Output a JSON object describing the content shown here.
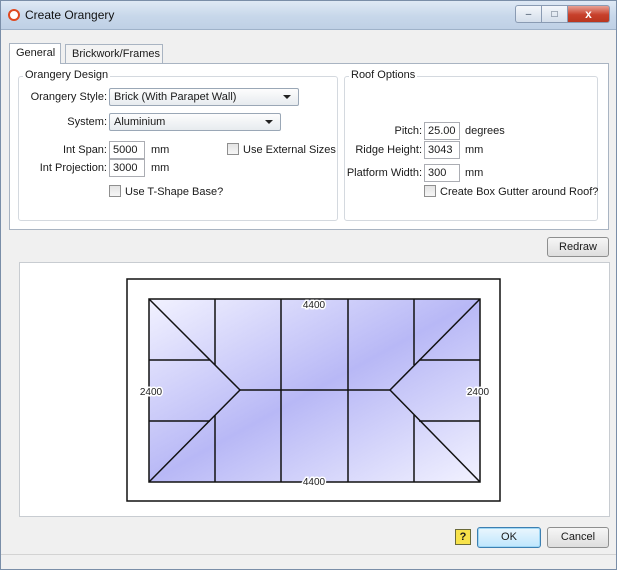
{
  "window": {
    "title": "Create Orangery",
    "minimize_glyph": "–",
    "maximize_glyph": "□",
    "close_glyph": "x"
  },
  "tabs": [
    {
      "label": "General",
      "active": true
    },
    {
      "label": "Brickwork/Frames",
      "active": false
    }
  ],
  "design": {
    "group_title": "Orangery Design",
    "style_label": "Orangery Style:",
    "style_value": "Brick (With Parapet Wall)",
    "system_label": "System:",
    "system_value": "Aluminium",
    "span_label": "Int Span:",
    "span_value": "5000",
    "span_unit": "mm",
    "projection_label": "Int Projection:",
    "projection_value": "3000",
    "projection_unit": "mm",
    "external_sizes_label": "Use External Sizes",
    "external_sizes_checked": false,
    "tshape_label": "Use T-Shape Base?",
    "tshape_checked": false
  },
  "roof": {
    "group_title": "Roof Options",
    "pitch_label": "Pitch:",
    "pitch_value": "25.00",
    "pitch_unit": "degrees",
    "ridge_label": "Ridge Height:",
    "ridge_value": "3043",
    "ridge_unit": "mm",
    "platform_label": "Platform Width:",
    "platform_value": "300",
    "platform_unit": "mm",
    "box_gutter_label": "Create Box Gutter around Roof?",
    "box_gutter_checked": false
  },
  "buttons": {
    "redraw": "Redraw",
    "help_glyph": "?",
    "ok": "OK",
    "cancel": "Cancel"
  },
  "drawing": {
    "top_dimension": "4400",
    "bottom_dimension": "4400",
    "left_dimension": "2400",
    "right_dimension": "2400",
    "glass_color_light": "#f2f2ff",
    "glass_color_dark": "#b8b8f6"
  }
}
